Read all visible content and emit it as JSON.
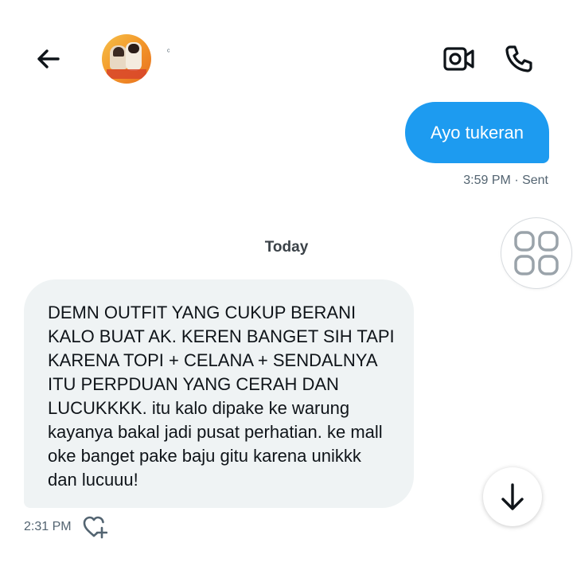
{
  "header": {
    "back_icon": "arrow-left-icon",
    "name": "ᶜ",
    "video_icon": "video-camera-icon",
    "phone_icon": "phone-icon"
  },
  "messages": {
    "sent": {
      "text": "Ayo tukeran",
      "meta": "3:59 PM · Sent"
    },
    "day_separator": "Today",
    "received": {
      "text": "DEMN OUTFIT YANG CUKUP BERANI\nKALO BUAT AK. KEREN BANGET SIH TAPI\nKARENA TOPI + CELANA + SENDALNYA\nITU PERPDUAN YANG CERAH DAN\nLUCUKKKK. itu kalo dipake ke warung\nkayanya bakal jadi pusat perhatian. ke mall\noke banget pake baju gitu karena unikkk\ndan lucuuu!",
      "time": "2:31 PM"
    }
  },
  "controls": {
    "grid_icon": "grid-icon",
    "react_icon": "heart-plus-icon",
    "scroll_icon": "arrow-down-icon"
  },
  "colors": {
    "accent": "#1d9bf0",
    "received_bubble": "#eff3f4",
    "muted_text": "#536471"
  }
}
